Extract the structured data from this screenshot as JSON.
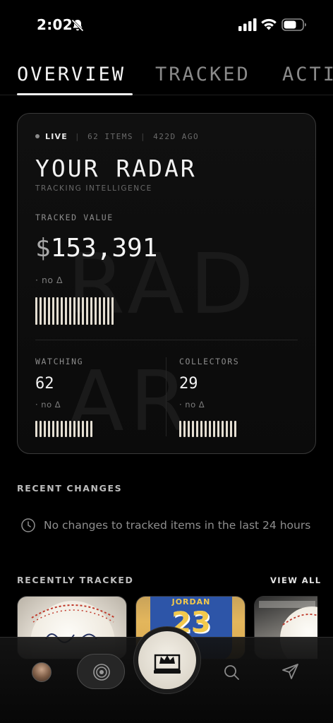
{
  "status_bar": {
    "time": "2:02"
  },
  "tabs": [
    {
      "label": "OVERVIEW",
      "active": true
    },
    {
      "label": "TRACKED",
      "active": false
    },
    {
      "label": "ACTI",
      "active": false
    }
  ],
  "radar_card": {
    "meta": {
      "live": "LIVE",
      "items": "62 ITEMS",
      "age": "422D AGO"
    },
    "title": "YOUR RADAR",
    "subtitle": "TRACKING INTELLIGENCE",
    "watermark_top": "RAD",
    "watermark_bottom": "AR",
    "tracked_value_label": "TRACKED VALUE",
    "currency": "$",
    "tracked_value": "153,391",
    "tracked_delta": "· no Δ",
    "watching": {
      "label": "WATCHING",
      "value": "62",
      "delta": "· no Δ"
    },
    "collectors": {
      "label": "COLLECTORS",
      "value": "29",
      "delta": "· no Δ"
    }
  },
  "recent_changes": {
    "title": "RECENT CHANGES",
    "empty_text": "No changes to tracked items in the last 24 hours"
  },
  "recently_tracked": {
    "title": "RECENTLY TRACKED",
    "view_all": "VIEW ALL",
    "items": [
      {
        "kind": "signed-baseball"
      },
      {
        "kind": "jersey",
        "name": "JORDAN",
        "number": "23"
      },
      {
        "kind": "baseball-case"
      }
    ]
  },
  "bottom_nav": {
    "items": [
      "avatar",
      "radar-icon",
      "home-crown-icon",
      "search-icon",
      "send-icon"
    ]
  },
  "colors": {
    "accent_cream": "#e4ded2",
    "background": "#000000"
  }
}
